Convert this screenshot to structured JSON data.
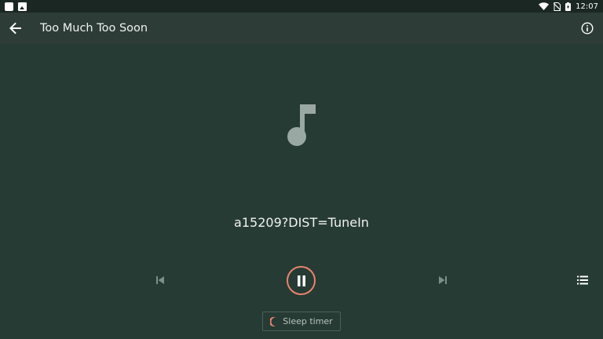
{
  "status_bar": {
    "time": "12:07",
    "icons": [
      "notification-square-icon",
      "image-notification-icon",
      "wifi-icon",
      "no-sim-icon",
      "battery-charging-icon"
    ]
  },
  "toolbar": {
    "title": "Too Much Too Soon",
    "back_icon": "arrow-back-icon",
    "info_icon": "info-icon"
  },
  "player": {
    "art_icon": "music-note-icon",
    "stream_title": "a15209?DIST=TuneIn",
    "state": "playing",
    "controls": {
      "previous_icon": "skip-previous-icon",
      "play_pause_icon": "pause-icon",
      "next_icon": "skip-next-icon",
      "queue_icon": "queue-list-icon"
    },
    "sleep_timer": {
      "label": "Sleep timer",
      "icon": "moon-icon"
    }
  },
  "colors": {
    "background": "#263b34",
    "toolbar": "#2d3c37",
    "status_bar": "#1a2722",
    "accent": "#e9846f",
    "icon_muted": "#8fa39c"
  }
}
